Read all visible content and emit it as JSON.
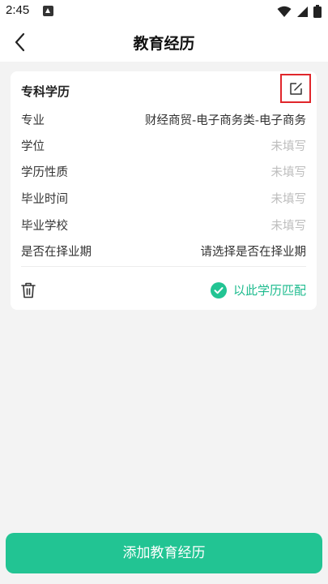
{
  "status_bar": {
    "time": "2:45"
  },
  "nav": {
    "title": "教育经历"
  },
  "card": {
    "title": "专科学历",
    "rows": [
      {
        "label": "专业",
        "value": "财经商贸-电子商务类-电子商务",
        "filled": true
      },
      {
        "label": "学位",
        "value": "未填写",
        "filled": false
      },
      {
        "label": "学历性质",
        "value": "未填写",
        "filled": false
      },
      {
        "label": "毕业时间",
        "value": "未填写",
        "filled": false
      },
      {
        "label": "毕业学校",
        "value": "未填写",
        "filled": false
      },
      {
        "label": "是否在择业期",
        "value": "请选择是否在择业期",
        "filled": true
      }
    ],
    "match_label": "以此学历匹配"
  },
  "footer": {
    "add_button_label": "添加教育经历"
  },
  "colors": {
    "accent": "#22c493",
    "match_text": "#1dbb8e",
    "highlight_border": "#e0262b",
    "placeholder_text": "#bdbdbd"
  },
  "icons": {
    "back": "back-arrow-icon",
    "edit": "edit-icon",
    "delete": "trash-icon",
    "match": "check-circle-icon"
  }
}
